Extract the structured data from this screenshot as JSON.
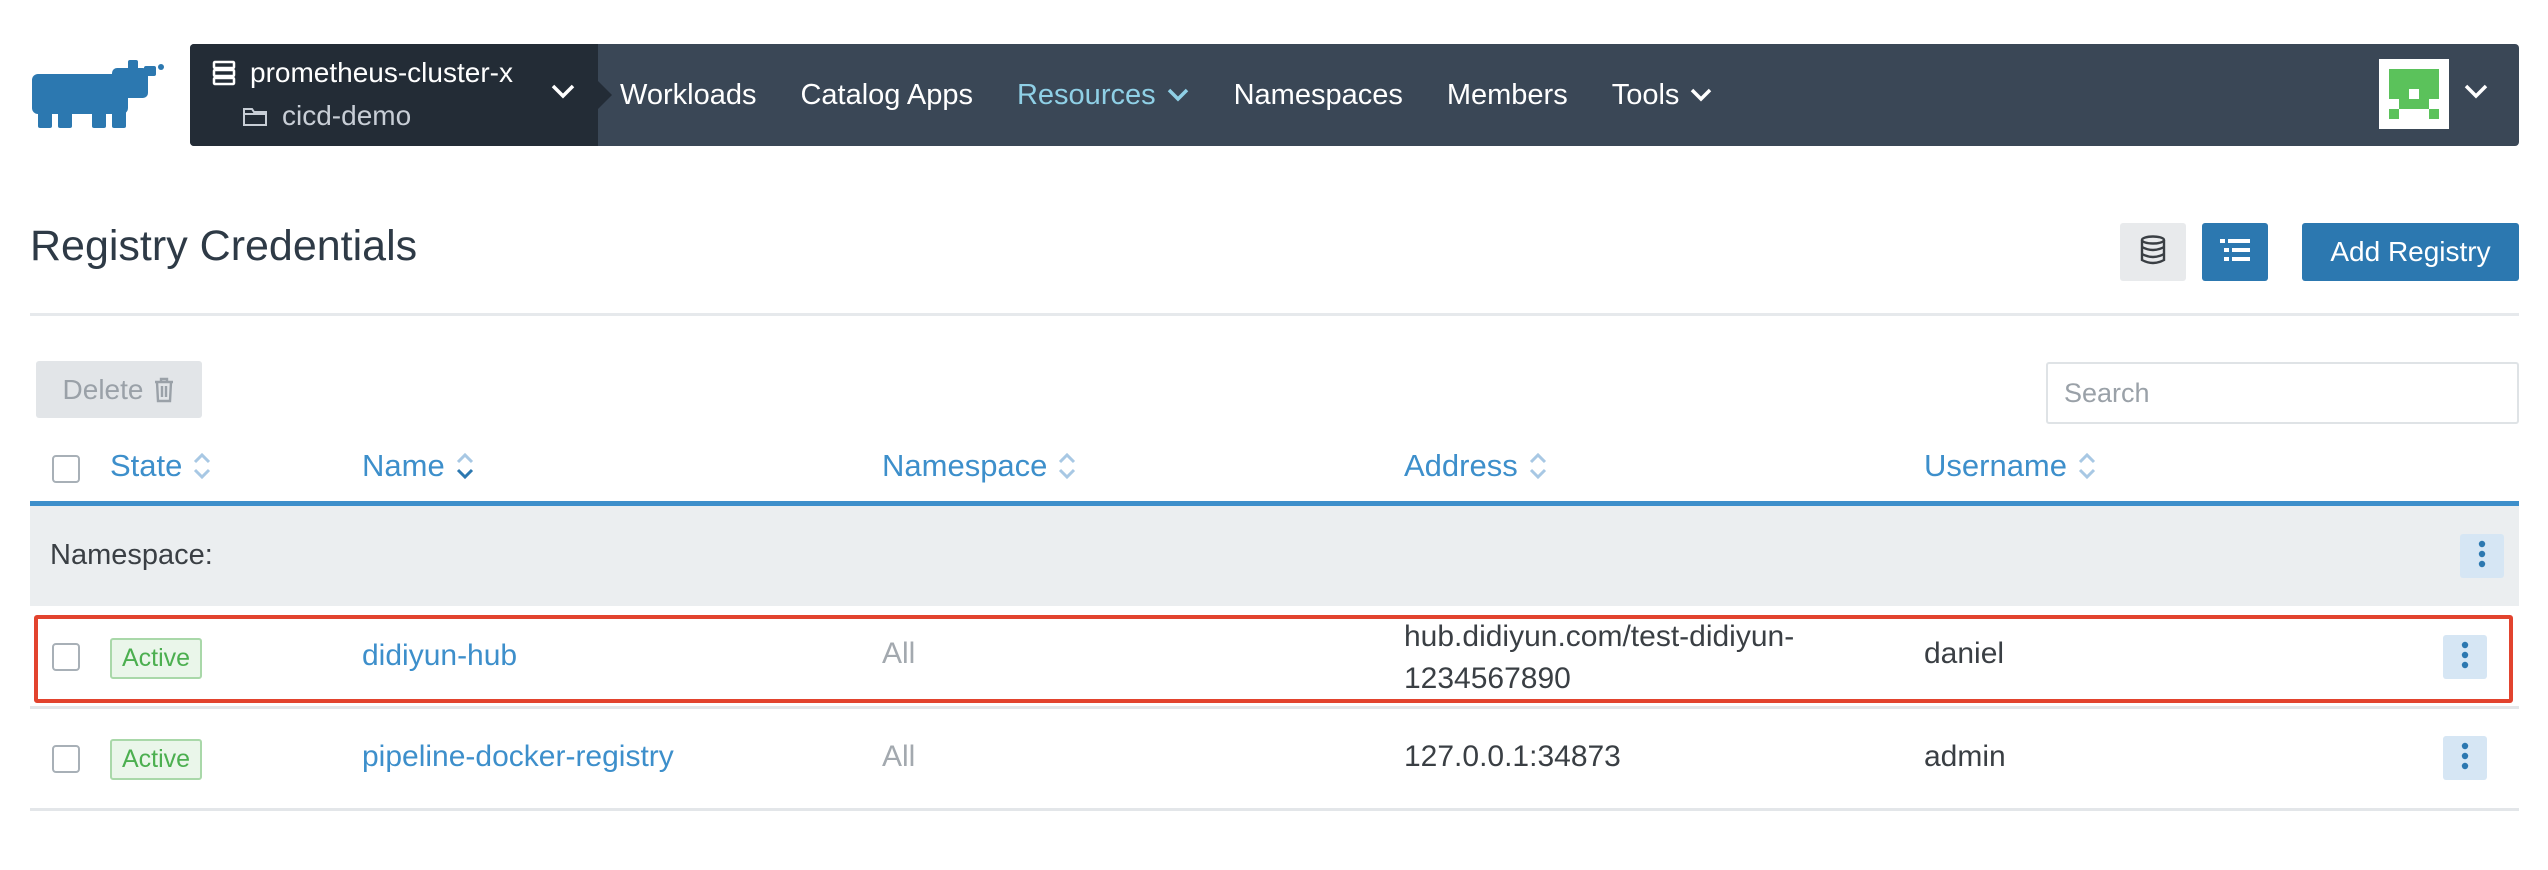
{
  "colors": {
    "topbar": "#3a4756",
    "cluster_box": "#232c36",
    "accent": "#2c78b0",
    "link": "#3d8fcb",
    "active_nav": "#8fd0e6",
    "active_badge": "#4caf50",
    "highlight": "#e2432e"
  },
  "header": {
    "cluster_name": "prometheus-cluster-x",
    "project_name": "cicd-demo",
    "nav": [
      {
        "label": "Workloads"
      },
      {
        "label": "Catalog Apps"
      },
      {
        "label": "Resources"
      },
      {
        "label": "Namespaces"
      },
      {
        "label": "Members"
      },
      {
        "label": "Tools"
      }
    ],
    "active_nav": "Resources",
    "icons": {
      "logo": "rancher-cow-logo",
      "cluster": "server-stack-icon",
      "project": "folder-icon",
      "avatar": "identicon-avatar"
    }
  },
  "page": {
    "title": "Registry Credentials",
    "add_button": "Add Registry",
    "view_toggle": [
      "grouped-view-icon",
      "list-view-icon"
    ]
  },
  "toolbar": {
    "delete_label": "Delete",
    "search_placeholder": "Search"
  },
  "table": {
    "columns": [
      "State",
      "Name",
      "Namespace",
      "Address",
      "Username"
    ],
    "group_label": "Namespace:",
    "rows": [
      {
        "state": "Active",
        "name": "didiyun-hub",
        "namespace": "All",
        "address_line1": "hub.didiyun.com/test-didiyun-",
        "address_line2": "1234567890",
        "username": "daniel"
      },
      {
        "state": "Active",
        "name": "pipeline-docker-registry",
        "namespace": "All",
        "address_line1": "127.0.0.1:34873",
        "address_line2": "",
        "username": "admin"
      }
    ]
  }
}
